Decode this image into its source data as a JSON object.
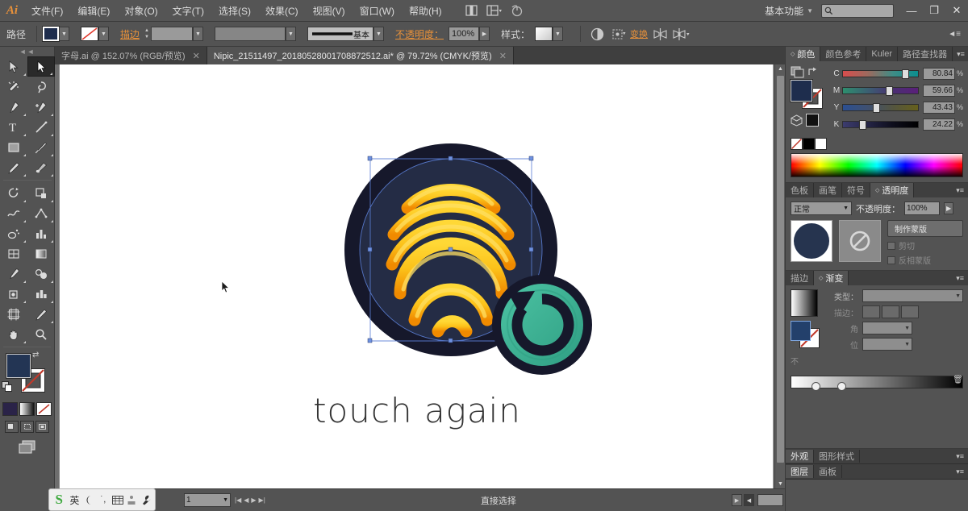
{
  "app": {
    "logo": "Ai",
    "workspace": "基本功能",
    "search_placeholder": ""
  },
  "menu": {
    "items": [
      {
        "label": "文件(F)"
      },
      {
        "label": "编辑(E)"
      },
      {
        "label": "对象(O)"
      },
      {
        "label": "文字(T)"
      },
      {
        "label": "选择(S)"
      },
      {
        "label": "效果(C)"
      },
      {
        "label": "视图(V)"
      },
      {
        "label": "窗口(W)"
      },
      {
        "label": "帮助(H)"
      }
    ],
    "icons": [
      "bridge-icon",
      "arrange-documents-icon",
      "stock-icon"
    ]
  },
  "window_controls": {
    "minimize": "—",
    "restore": "❐",
    "close": "✕"
  },
  "control_bar": {
    "object_label": "路径",
    "fill_color": "#1e2d4d",
    "stroke_label": "描边",
    "stroke_value": "",
    "stroke_profile": "",
    "brush_label": "基本",
    "opacity_label": "不透明度：",
    "opacity_value": "100%",
    "style_label": "样式：",
    "transform_label": "变换",
    "icons": [
      "opacity-icon",
      "transform-icon",
      "align-icon",
      "distribute-icon",
      "panel-menu-icon"
    ]
  },
  "doc_tabs": [
    {
      "label": "字母.ai @ 152.07% (RGB/预览)",
      "active": false,
      "close": "✕"
    },
    {
      "label": "Nipic_21511497_20180528001708872512.ai* @ 79.72% (CMYK/预览)",
      "active": true,
      "close": "✕"
    }
  ],
  "toolbar": {
    "tools": [
      {
        "name": "selection-tool",
        "glyph": "selection",
        "selected": false,
        "corner": true
      },
      {
        "name": "direct-selection-tool",
        "glyph": "direct-selection",
        "selected": true,
        "corner": true
      },
      {
        "name": "magic-wand-tool",
        "glyph": "magic-wand",
        "selected": false,
        "corner": false
      },
      {
        "name": "lasso-tool",
        "glyph": "lasso",
        "selected": false,
        "corner": false
      },
      {
        "name": "pen-tool",
        "glyph": "pen",
        "selected": false,
        "corner": true
      },
      {
        "name": "add-anchor-point-tool",
        "glyph": "pen-add",
        "selected": false,
        "corner": true
      },
      {
        "name": "type-tool",
        "glyph": "type",
        "selected": false,
        "corner": true
      },
      {
        "name": "line-segment-tool",
        "glyph": "line",
        "selected": false,
        "corner": true
      },
      {
        "name": "rectangle-tool",
        "glyph": "rectangle",
        "selected": false,
        "corner": true
      },
      {
        "name": "paintbrush-tool",
        "glyph": "brush",
        "selected": false,
        "corner": true
      },
      {
        "name": "pencil-tool",
        "glyph": "pencil",
        "selected": false,
        "corner": true
      },
      {
        "name": "blob-brush-tool",
        "glyph": "blob",
        "selected": false,
        "corner": true
      },
      {
        "name": "rotate-tool",
        "glyph": "rotate",
        "selected": false,
        "corner": true
      },
      {
        "name": "reflect-tool",
        "glyph": "reflect",
        "selected": false,
        "corner": true
      },
      {
        "name": "warp-tool",
        "glyph": "warp",
        "selected": false,
        "corner": true
      },
      {
        "name": "free-transform-tool",
        "glyph": "free-transform",
        "selected": false,
        "corner": true
      },
      {
        "name": "symbol-sprayer-tool",
        "glyph": "symbol-sprayer",
        "selected": false,
        "corner": true
      },
      {
        "name": "column-graph-tool",
        "glyph": "graph",
        "selected": false,
        "corner": true
      },
      {
        "name": "mesh-tool",
        "glyph": "mesh",
        "selected": false,
        "corner": false
      },
      {
        "name": "gradient-tool",
        "glyph": "gradient",
        "selected": false,
        "corner": false
      },
      {
        "name": "eyedropper-tool",
        "glyph": "eyedropper",
        "selected": false,
        "corner": true
      },
      {
        "name": "blend-tool",
        "glyph": "blend",
        "selected": false,
        "corner": true
      },
      {
        "name": "live-paint-bucket-tool",
        "glyph": "paint-bucket",
        "selected": false,
        "corner": true
      },
      {
        "name": "live-paint-selection-tool",
        "glyph": "paint-select",
        "selected": false,
        "corner": true
      },
      {
        "name": "artboard-tool",
        "glyph": "artboard",
        "selected": false,
        "corner": false
      },
      {
        "name": "slice-tool",
        "glyph": "slice",
        "selected": false,
        "corner": true
      },
      {
        "name": "hand-tool",
        "glyph": "hand",
        "selected": false,
        "corner": true
      },
      {
        "name": "zoom-tool",
        "glyph": "zoom",
        "selected": false,
        "corner": false
      }
    ],
    "fill_color": "#233554",
    "stroke_color": "none",
    "mode_buttons": [
      "color-mode",
      "gradient-mode",
      "none-mode"
    ],
    "draw_modes": [
      "draw-normal",
      "draw-behind",
      "draw-inside"
    ],
    "screen_mode": "change-screen-mode"
  },
  "canvas": {
    "artwork": {
      "title": "touch again",
      "colors": {
        "circle_dark": "#16182b",
        "circle_inner": "#242c45",
        "arc_yellow": "#ffd02e",
        "arc_orange": "#f29100",
        "badge_teal": "#36ad8e",
        "badge_dark": "#16182b"
      }
    },
    "cursor": "arrow-cursor"
  },
  "status_bar": {
    "artboard_number": "1",
    "tool_status": "直接选择"
  },
  "ime": {
    "name": "sogou-ime",
    "logo": "S",
    "mode": "英",
    "icons": [
      "moon-icon",
      "punct-icon",
      "keyboard-icon",
      "toolbox-icon",
      "wrench-icon"
    ]
  },
  "panels": {
    "color_panel": {
      "tabs": [
        {
          "label": "颜色",
          "active": true,
          "dot": "◇"
        },
        {
          "label": "颜色参考",
          "active": false
        },
        {
          "label": "Kuler",
          "active": false
        },
        {
          "label": "路径查找器",
          "active": false
        }
      ],
      "menu": "▾≡",
      "channels": [
        {
          "letter": "C",
          "value": "80.84",
          "pct": "%",
          "pos": 81,
          "ramp_from": "#d14a4a",
          "ramp_to": "#0c8d8d"
        },
        {
          "letter": "M",
          "value": "59.66",
          "pct": "%",
          "pos": 60,
          "ramp_from": "#2e8f6f",
          "ramp_to": "#4a1f6b"
        },
        {
          "letter": "Y",
          "value": "43.43",
          "pct": "%",
          "pos": 43,
          "ramp_from": "#2c4f8f",
          "ramp_to": "#5a5a1c"
        },
        {
          "letter": "K",
          "value": "24.22",
          "pct": "%",
          "pos": 24,
          "ramp_from": "#3d3d6b",
          "ramp_to": "#000000"
        }
      ],
      "mini_swatches": [
        "none-swatch",
        "black-swatch",
        "white-swatch"
      ],
      "fill_color": "#1e2d4d"
    },
    "transparency_panel": {
      "tabs": [
        {
          "label": "色板",
          "active": false
        },
        {
          "label": "画笔",
          "active": false
        },
        {
          "label": "符号",
          "active": false
        },
        {
          "label": "透明度",
          "active": true,
          "dot": "◇"
        }
      ],
      "menu": "▾≡",
      "blend_mode": "正常",
      "opacity_label": "不透明度：",
      "opacity_value": "100%",
      "make_mask_button": "制作蒙版",
      "clip_checkbox": "剪切",
      "invert_mask_checkbox": "反相蒙版",
      "thumb_color": "#26344f"
    },
    "gradient_panel": {
      "tabs": [
        {
          "label": "描边",
          "active": false
        },
        {
          "label": "渐变",
          "active": true,
          "dot": "◇"
        }
      ],
      "menu": "▾≡",
      "type_label": "类型：",
      "type_value": "",
      "stroke_label": "描边：",
      "angle_label": "角",
      "angle_value": "",
      "ratio_label": "位",
      "ratio_value": "",
      "opacity_label": "不",
      "location_label": "位"
    },
    "appearance_panel": {
      "tabs": [
        {
          "label": "外观",
          "active": true
        },
        {
          "label": "图形样式",
          "active": false
        }
      ],
      "menu": "▾≡"
    },
    "layers_panel": {
      "tabs": [
        {
          "label": "图层",
          "active": true
        },
        {
          "label": "画板",
          "active": false
        }
      ],
      "menu": "▾≡"
    }
  }
}
